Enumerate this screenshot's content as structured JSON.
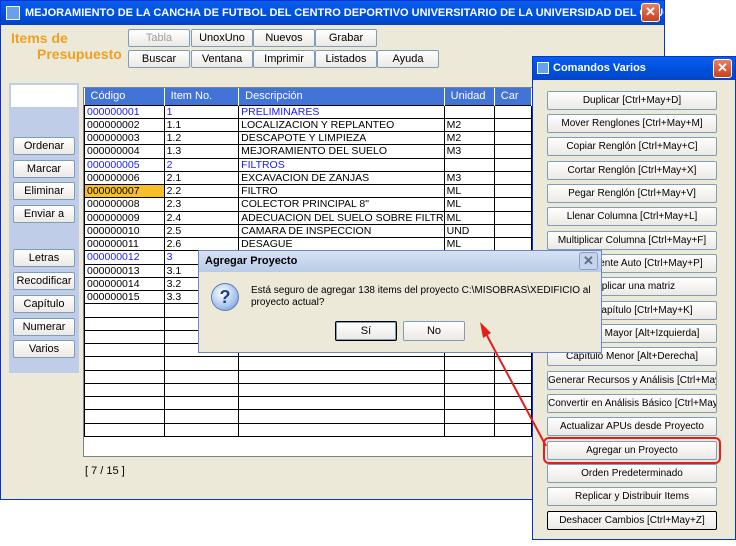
{
  "main_window": {
    "title": "MEJORAMIENTO DE LA CANCHA DE FUTBOL DEL CENTRO DEPORTIVO UNIVERSITARIO DE LA UNIVERSIDAD DEL CAUCA - C...",
    "close": "✕",
    "brand_line1": "Items de",
    "brand_line2": "Presupuesto"
  },
  "toolbar": {
    "tabla": "Tabla",
    "unoxuno": "UnoxUno",
    "nuevos": "Nuevos",
    "grabar": "Grabar",
    "buscar": "Buscar",
    "ventana": "Ventana",
    "imprimir": "Imprimir",
    "listados": "Listados",
    "ayuda": "Ayuda"
  },
  "sidebar": {
    "ordenar": "Ordenar",
    "marcar": "Marcar",
    "eliminar": "Eliminar",
    "enviar": "Enviar a",
    "letras": "Letras",
    "recodificar": "Recodificar",
    "capitulo": "Capítulo",
    "numerar": "Numerar",
    "varios": "Varios"
  },
  "grid": {
    "headers": [
      "Código",
      "Item No.",
      "Descripción",
      "Unidad",
      "Car"
    ],
    "rows": [
      [
        "000000001",
        "1",
        "PRELIMINARES",
        ""
      ],
      [
        "000000002",
        "1.1",
        "LOCALIZACION Y REPLANTEO",
        "M2"
      ],
      [
        "000000003",
        "1.2",
        "DESCAPOTE Y LIMPIEZA",
        "M2"
      ],
      [
        "000000004",
        "1.3",
        "MEJORAMIENTO DEL SUELO",
        "M3"
      ],
      [
        "000000005",
        "2",
        "FILTROS",
        ""
      ],
      [
        "000000006",
        "2.1",
        "EXCAVACION DE ZANJAS",
        "M3"
      ],
      [
        "000000007",
        "2.2",
        "FILTRO",
        "ML"
      ],
      [
        "000000008",
        "2.3",
        "COLECTOR PRINCIPAL 8\"",
        "ML"
      ],
      [
        "000000009",
        "2.4",
        "ADECUACION DEL SUELO SOBRE FILTR",
        "ML"
      ],
      [
        "000000010",
        "2.5",
        "CAMARA DE INSPECCION",
        "UND"
      ],
      [
        "000000011",
        "2.6",
        "DESAGUE",
        "ML"
      ],
      [
        "000000012",
        "3",
        "",
        ""
      ],
      [
        "000000013",
        "3.1",
        "",
        ""
      ],
      [
        "000000014",
        "3.2",
        "",
        ""
      ],
      [
        "000000015",
        "3.3",
        "",
        ""
      ]
    ],
    "pager": "[ 7 / 15 ]"
  },
  "comandos": {
    "title": "Comandos Varios",
    "close": "✕",
    "buttons": [
      "Duplicar [Ctrl+May+D]",
      "Mover Renglones [Ctrl+May+M]",
      "Copiar Renglón [Ctrl+May+C]",
      "Cortar Renglón [Ctrl+May+X]",
      "Pegar Renglón [Ctrl+May+V]",
      "Llenar Columna [Ctrl+May+L]",
      "Multiplicar Columna [Ctrl+May+F]",
      "Componente Auto [Ctrl+May+P]",
      "Duplicar una matriz",
      "Item-Capítulo [Ctrl+May+K]",
      "Capítulo Mayor [Alt+Izquierda]",
      "Capítulo Menor [Alt+Derecha]",
      "Generar Recursos y Análisis [Ctrl+May+Y]",
      "Convertir en Análisis Básico [Ctrl+May+Q]",
      "Actualizar APUs desde Proyecto",
      "Agregar un Proyecto",
      "Orden Predeterminado",
      "Replicar y Distribuir Items",
      "Deshacer Cambios [Ctrl+May+Z]"
    ]
  },
  "dialog": {
    "title": "Agregar Proyecto",
    "close": "✕",
    "icon": "?",
    "message": "Está seguro de agregar 138 items del proyecto C:\\MISOBRAS\\XEDIFICIO al proyecto actual?",
    "yes": "Sí",
    "no": "No"
  },
  "colors": {
    "accent": "#4273d6",
    "brand": "#f0a020",
    "selected_cell": "#f8c028",
    "annotation": "#e0201c"
  }
}
